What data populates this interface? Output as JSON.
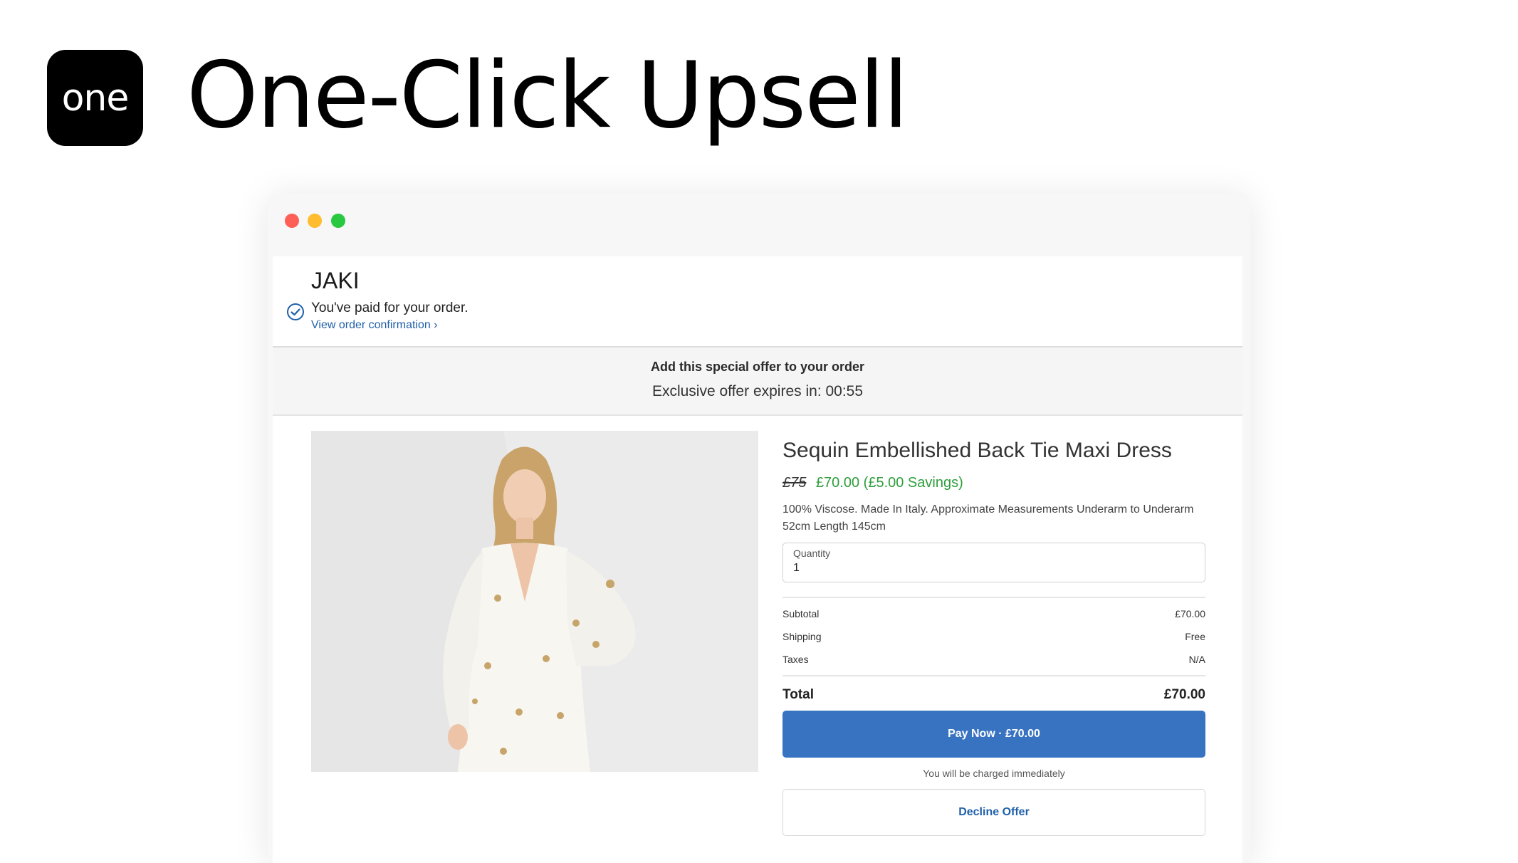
{
  "app": {
    "logo_text": "one",
    "title": "One-Click Upsell"
  },
  "store": {
    "name": "JAKI",
    "paid_message": "You've paid for your order.",
    "view_confirmation_link": "View order confirmation ›"
  },
  "offer": {
    "title": "Add this special offer to your order",
    "timer_text": "Exclusive offer expires in: 00:55"
  },
  "product": {
    "title": "Sequin Embellished Back Tie Maxi Dress",
    "old_price": "£75",
    "new_price": "£70.00 (£5.00 Savings)",
    "description": "100% Viscose. Made In Italy. Approximate Measurements  Underarm to Underarm 52cm Length 145cm",
    "quantity_label": "Quantity",
    "quantity_value": "1"
  },
  "summary": {
    "subtotal_label": "Subtotal",
    "subtotal_value": "£70.00",
    "shipping_label": "Shipping",
    "shipping_value": "Free",
    "taxes_label": "Taxes",
    "taxes_value": "N/A",
    "total_label": "Total",
    "total_value": "£70.00"
  },
  "actions": {
    "pay_label": "Pay Now · £70.00",
    "charge_note": "You will be charged immediately",
    "decline_label": "Decline Offer"
  },
  "colors": {
    "accent_blue": "#3873c1",
    "link_blue": "#1f5fa9",
    "savings_green": "#2e9e3c",
    "close_dot": "#fe5f57",
    "minimize_dot": "#febc2e",
    "maximize_dot": "#28c840"
  }
}
